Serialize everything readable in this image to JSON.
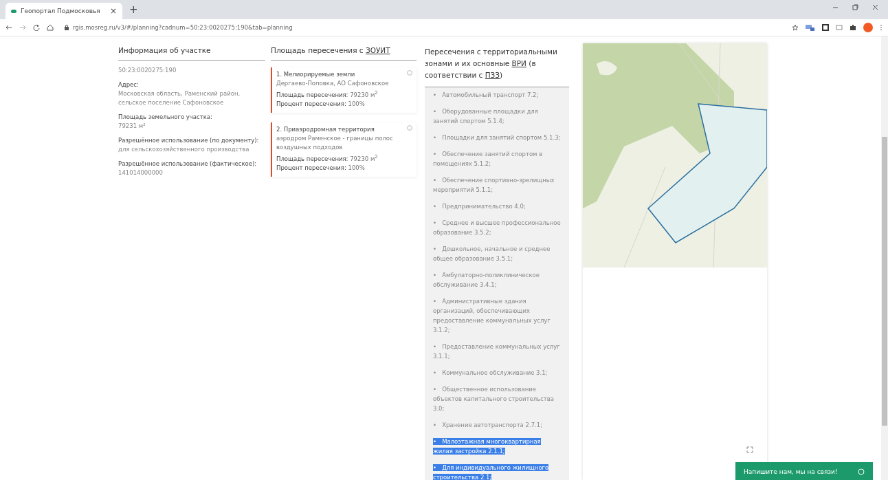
{
  "browser": {
    "tab_title": "Геопортал Подмосковья",
    "tab_close": "×",
    "new_tab": "+",
    "url": "rgis.mosreg.ru/v3/#/planning?cadnum=50:23:0020275:190&tab=planning"
  },
  "parcel_info": {
    "title": "Информация об участке",
    "cadnum": "50:23:0020275:190",
    "fields": [
      {
        "label": "Адрес:",
        "value": "Московская область, Раменский район, сельское поселение Сафоновское"
      },
      {
        "label": "Площадь земельного участка:",
        "value": "79231 м²"
      },
      {
        "label": "Разрешённое использование (по документу):",
        "value": "для сельскохозяйственного производства"
      },
      {
        "label": "Разрешённое использование (фактическое):",
        "value": "141014000000"
      }
    ]
  },
  "zouit": {
    "title_prefix": "Площадь пересечения с ",
    "title_link": "ЗОУИТ",
    "cards": [
      {
        "name": "1. Мелиорируемые земли",
        "detail": "Дергаево-Поповка, АО Сафоновское",
        "area_label": "Площадь пересечения:",
        "area": "79230 м$^{2}$",
        "percent_label": "Процент пересечения:",
        "percent": "100%"
      },
      {
        "name": "2. Приаэродромная территория",
        "detail": "аэродром Раменское - границы полос воздушных подходов",
        "area_label": "Площадь пересечения:",
        "area": "79230 м$^{2}$",
        "percent_label": "Процент пересечения:",
        "percent": "100%"
      }
    ]
  },
  "zones": {
    "title_parts": [
      "Пересечения с территориальными зонами и их основные ",
      "ВРИ",
      " (в соответствии с ",
      "ПЗЗ",
      ")"
    ],
    "marker": "•",
    "items": [
      {
        "text": "Автомобильный транспорт 7.2;",
        "highlighted": false
      },
      {
        "text": "Оборудованные площадки для занятий спортом 5.1.4;",
        "highlighted": false
      },
      {
        "text": "Площадки для занятий спортом 5.1.3;",
        "highlighted": false
      },
      {
        "text": "Обеспечение занятий спортом в помещениях 5.1.2;",
        "highlighted": false
      },
      {
        "text": "Обеспечение спортивно-зрелищных мероприятий 5.1.1;",
        "highlighted": false
      },
      {
        "text": "Предпринимательство 4.0;",
        "highlighted": false
      },
      {
        "text": "Среднее и высшее профессиональное образование 3.5.2;",
        "highlighted": false
      },
      {
        "text": "Дошкольное, начальное и среднее общее образование 3.5.1;",
        "highlighted": false
      },
      {
        "text": "Амбулаторно-поликлиническое обслуживание 3.4.1;",
        "highlighted": false
      },
      {
        "text": "Административные здания организаций, обеспечивающих предоставление коммунальных услуг 3.1.2;",
        "highlighted": false
      },
      {
        "text": "Предоставление коммунальных услуг 3.1.1;",
        "highlighted": false
      },
      {
        "text": "Коммунальное обслуживание 3.1;",
        "highlighted": false
      },
      {
        "text": "Общественное использование объектов капитального строительства 3.0;",
        "highlighted": false
      },
      {
        "text": "Хранение автотранспорта 2.7.1;",
        "highlighted": false
      },
      {
        "text": "Малоэтажная многоквартирная жилая застройка 2.1.1;",
        "highlighted": true
      },
      {
        "text": "Для индивидуального жилищного строительства 2.1;",
        "highlighted": true
      }
    ]
  },
  "chat": {
    "label": "Напишите нам, мы на связи!"
  }
}
